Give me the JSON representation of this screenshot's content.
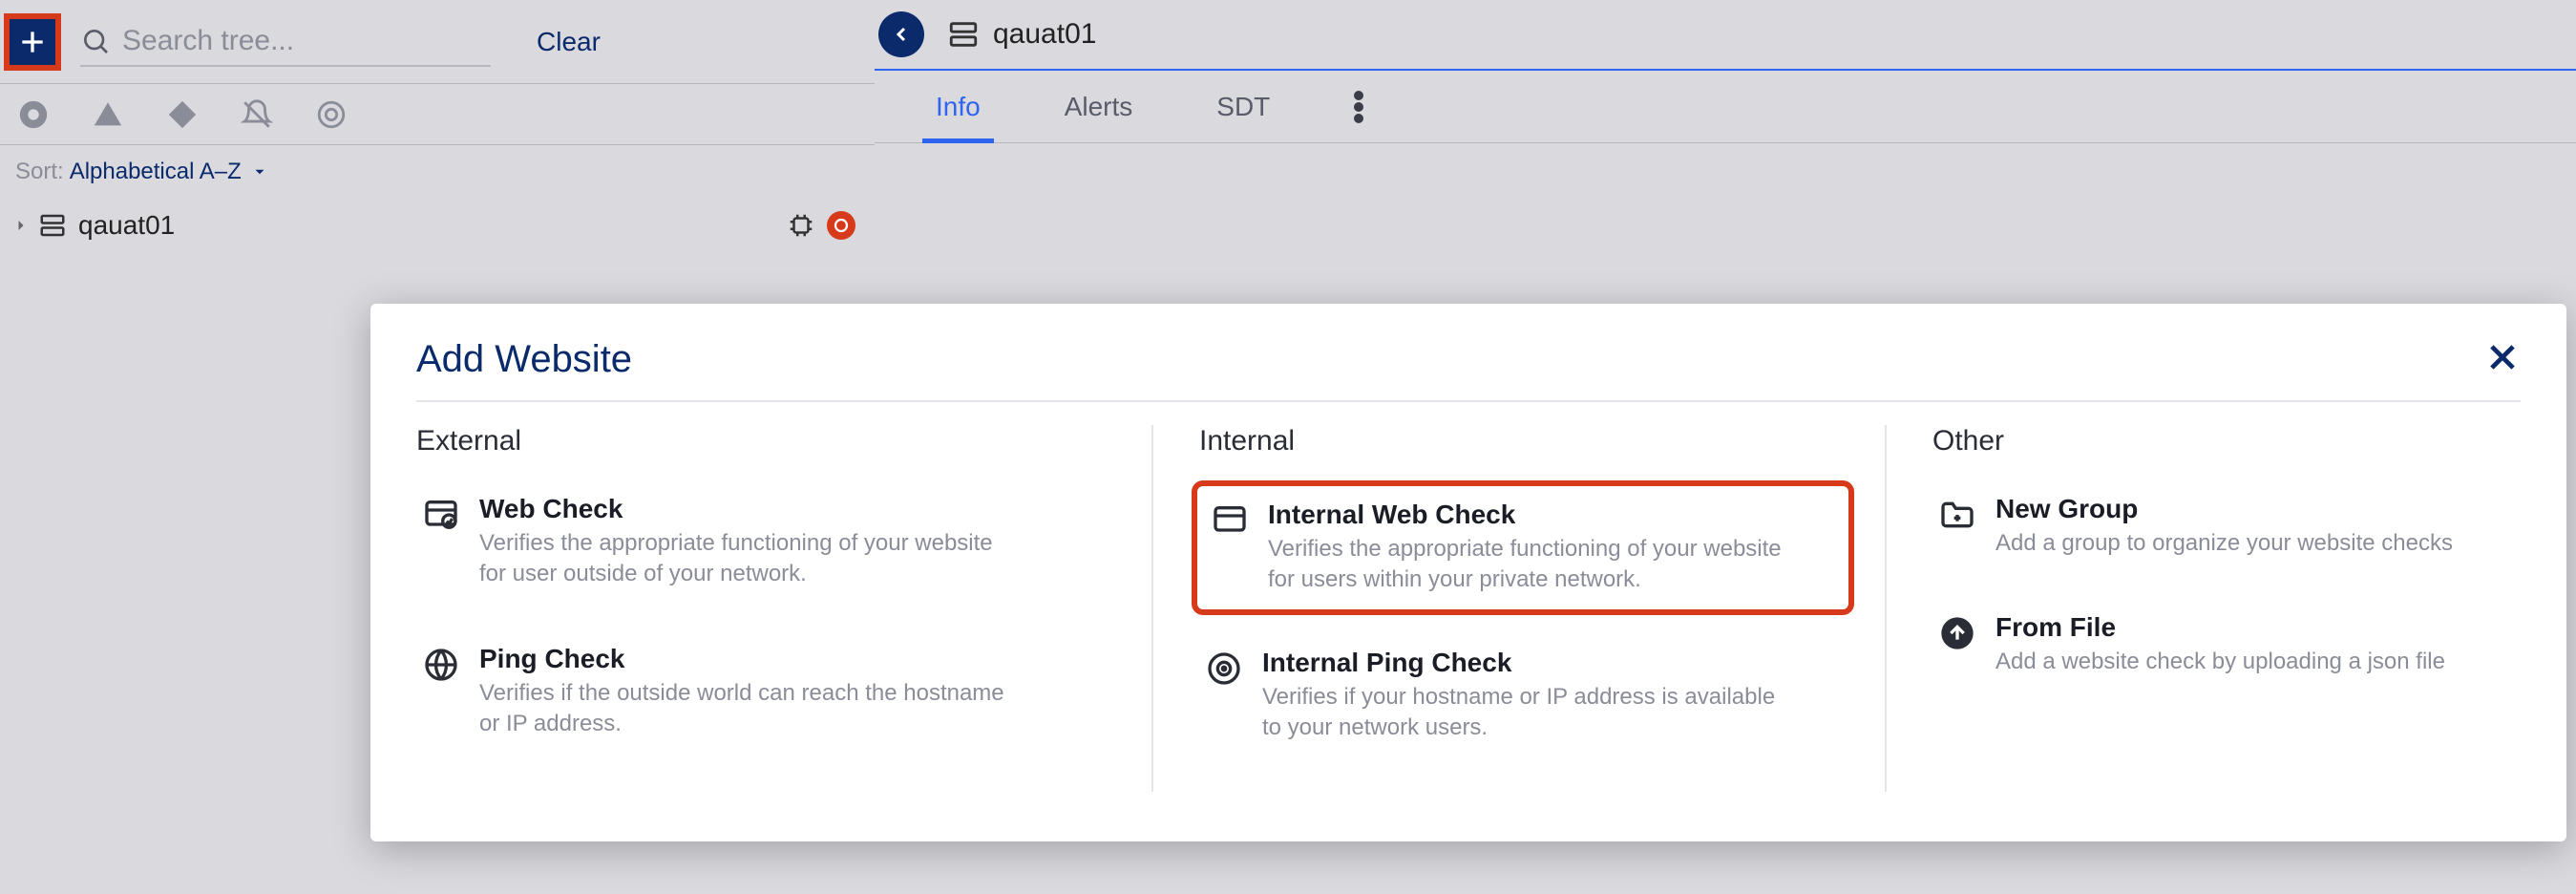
{
  "toolbar": {
    "search_placeholder": "Search tree...",
    "clear_label": "Clear"
  },
  "sort": {
    "label": "Sort:",
    "value": "Alphabetical A–Z"
  },
  "tree": {
    "items": [
      {
        "label": "qauat01"
      }
    ]
  },
  "header": {
    "title": "qauat01"
  },
  "tabs": [
    {
      "label": "Info",
      "active": true
    },
    {
      "label": "Alerts",
      "active": false
    },
    {
      "label": "SDT",
      "active": false
    }
  ],
  "modal": {
    "title": "Add Website",
    "columns": [
      {
        "heading": "External",
        "options": [
          {
            "icon": "browser-check",
            "title": "Web Check",
            "desc": "Verifies the appropriate functioning of your website for user outside of your network.",
            "highlight": false
          },
          {
            "icon": "ping-globe",
            "title": "Ping Check",
            "desc": "Verifies if the outside world can reach the hostname or IP address.",
            "highlight": false
          }
        ]
      },
      {
        "heading": "Internal",
        "options": [
          {
            "icon": "browser",
            "title": "Internal Web Check",
            "desc": "Verifies the appropriate functioning of your website for users within your private network.",
            "highlight": true
          },
          {
            "icon": "ping-target",
            "title": "Internal Ping Check",
            "desc": "Verifies if your hostname or IP address is available to your network users.",
            "highlight": false
          }
        ]
      },
      {
        "heading": "Other",
        "options": [
          {
            "icon": "folder-plus",
            "title": "New Group",
            "desc": "Add a group to organize your website checks",
            "highlight": false
          },
          {
            "icon": "upload",
            "title": "From File",
            "desc": "Add a website check by uploading a json file",
            "highlight": false
          }
        ]
      }
    ]
  }
}
